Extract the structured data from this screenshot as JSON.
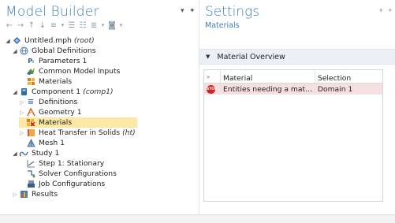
{
  "left_panel": {
    "title": "Model Builder"
  },
  "tree": {
    "untitled": {
      "label": "Untitled.mph",
      "tag": "(root)"
    },
    "global_definitions": "Global Definitions",
    "parameters": "Parameters 1",
    "common_inputs": "Common Model Inputs",
    "global_materials": "Materials",
    "component": {
      "label": "Component 1",
      "tag": "(comp1)"
    },
    "definitions": "Definitions",
    "geometry": "Geometry 1",
    "materials": "Materials",
    "heat_transfer": {
      "label": "Heat Transfer in Solids",
      "tag": "(ht)"
    },
    "mesh": "Mesh 1",
    "study": "Study 1",
    "step": "Step 1: Stationary",
    "solver": "Solver Configurations",
    "job": "Job Configurations",
    "results": "Results"
  },
  "right_panel": {
    "title": "Settings",
    "subtitle": "Materials",
    "section_title": "Material Overview",
    "table": {
      "headers": {
        "material": "Material",
        "selection": "Selection"
      },
      "rows": [
        {
          "icon": "stop-icon",
          "icon_text": "STOP",
          "material": "Entities needing a mat...",
          "selection": "Domain 1"
        }
      ]
    }
  },
  "colors": {
    "title_blue": "#3d7fb5",
    "tree_selected": "#fce8a4",
    "section_bg": "#eaf0f6",
    "row_selected": "#f5dfe0",
    "stop_red": "#d32424"
  }
}
